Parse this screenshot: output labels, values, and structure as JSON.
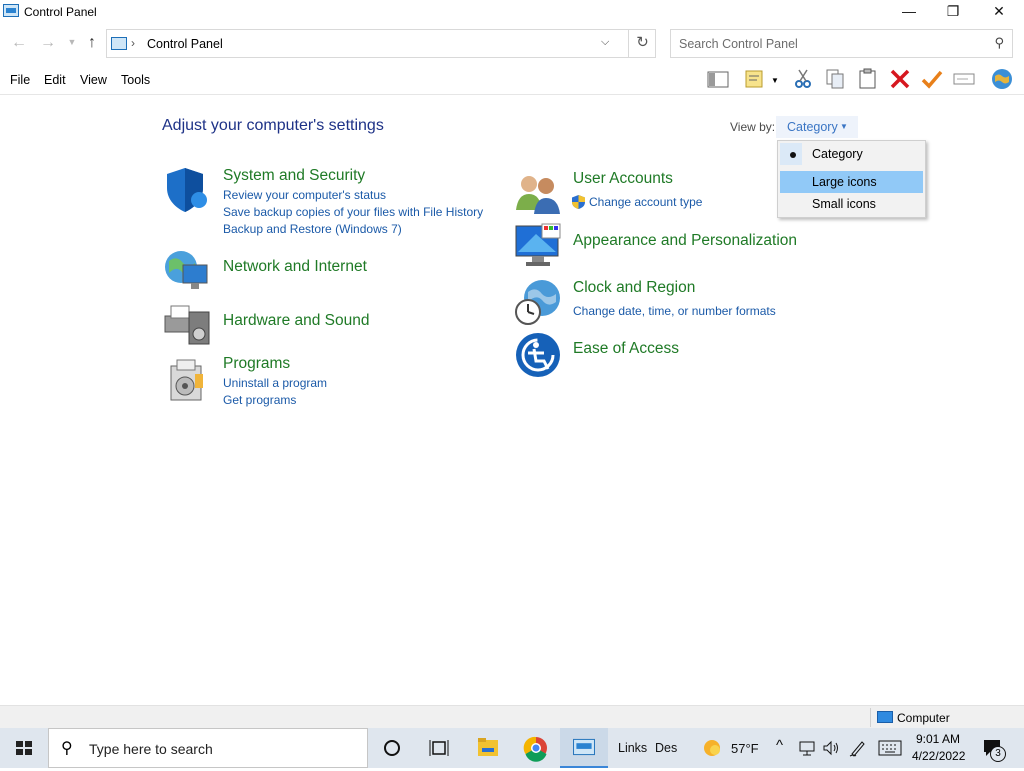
{
  "window": {
    "title": "Control Panel",
    "minimize": "—",
    "restore": "❐",
    "close": "✕"
  },
  "address": {
    "path": "Control Panel",
    "separator": "›",
    "search_placeholder": "Search Control Panel"
  },
  "menu": [
    "File",
    "Edit",
    "View",
    "Tools"
  ],
  "toolbar_icons": [
    "layout-pane-icon",
    "properties-icon",
    "cut-icon",
    "copy-icon",
    "paste-icon",
    "delete-icon",
    "checkmark-icon",
    "rename-icon",
    "globe-icon"
  ],
  "main": {
    "heading": "Adjust your computer's settings",
    "view_by_label": "View by:",
    "view_by_value": "Category",
    "categories_left": [
      {
        "title": "System and Security",
        "links": [
          "Review your computer's status",
          "Save backup copies of your files with File History",
          "Backup and Restore (Windows 7)"
        ]
      },
      {
        "title": "Network and Internet",
        "links": []
      },
      {
        "title": "Hardware and Sound",
        "links": []
      },
      {
        "title": "Programs",
        "links": [
          "Uninstall a program",
          "Get programs"
        ]
      }
    ],
    "categories_right": [
      {
        "title": "User Accounts",
        "links": [
          "Change account type"
        ]
      },
      {
        "title": "Appearance and Personalization",
        "links": []
      },
      {
        "title": "Clock and Region",
        "links": [
          "Change date, time, or number formats"
        ]
      },
      {
        "title": "Ease of Access",
        "links": []
      }
    ]
  },
  "view_menu": {
    "items": [
      "Category",
      "Large icons",
      "Small icons"
    ],
    "checked": "Category",
    "highlighted": "Large icons"
  },
  "statusbar": {
    "text": "Computer"
  },
  "taskbar": {
    "search_placeholder": "Type here to search",
    "links_label": "Links",
    "des_label": "Des",
    "weather": "57°F",
    "time": "9:01 AM",
    "date": "4/22/2022",
    "notification_count": "3"
  },
  "colors": {
    "heading": "#1e3287",
    "category_title": "#1f7a26",
    "link": "#1b5aa8",
    "menu_highlight": "#91c9f7"
  }
}
